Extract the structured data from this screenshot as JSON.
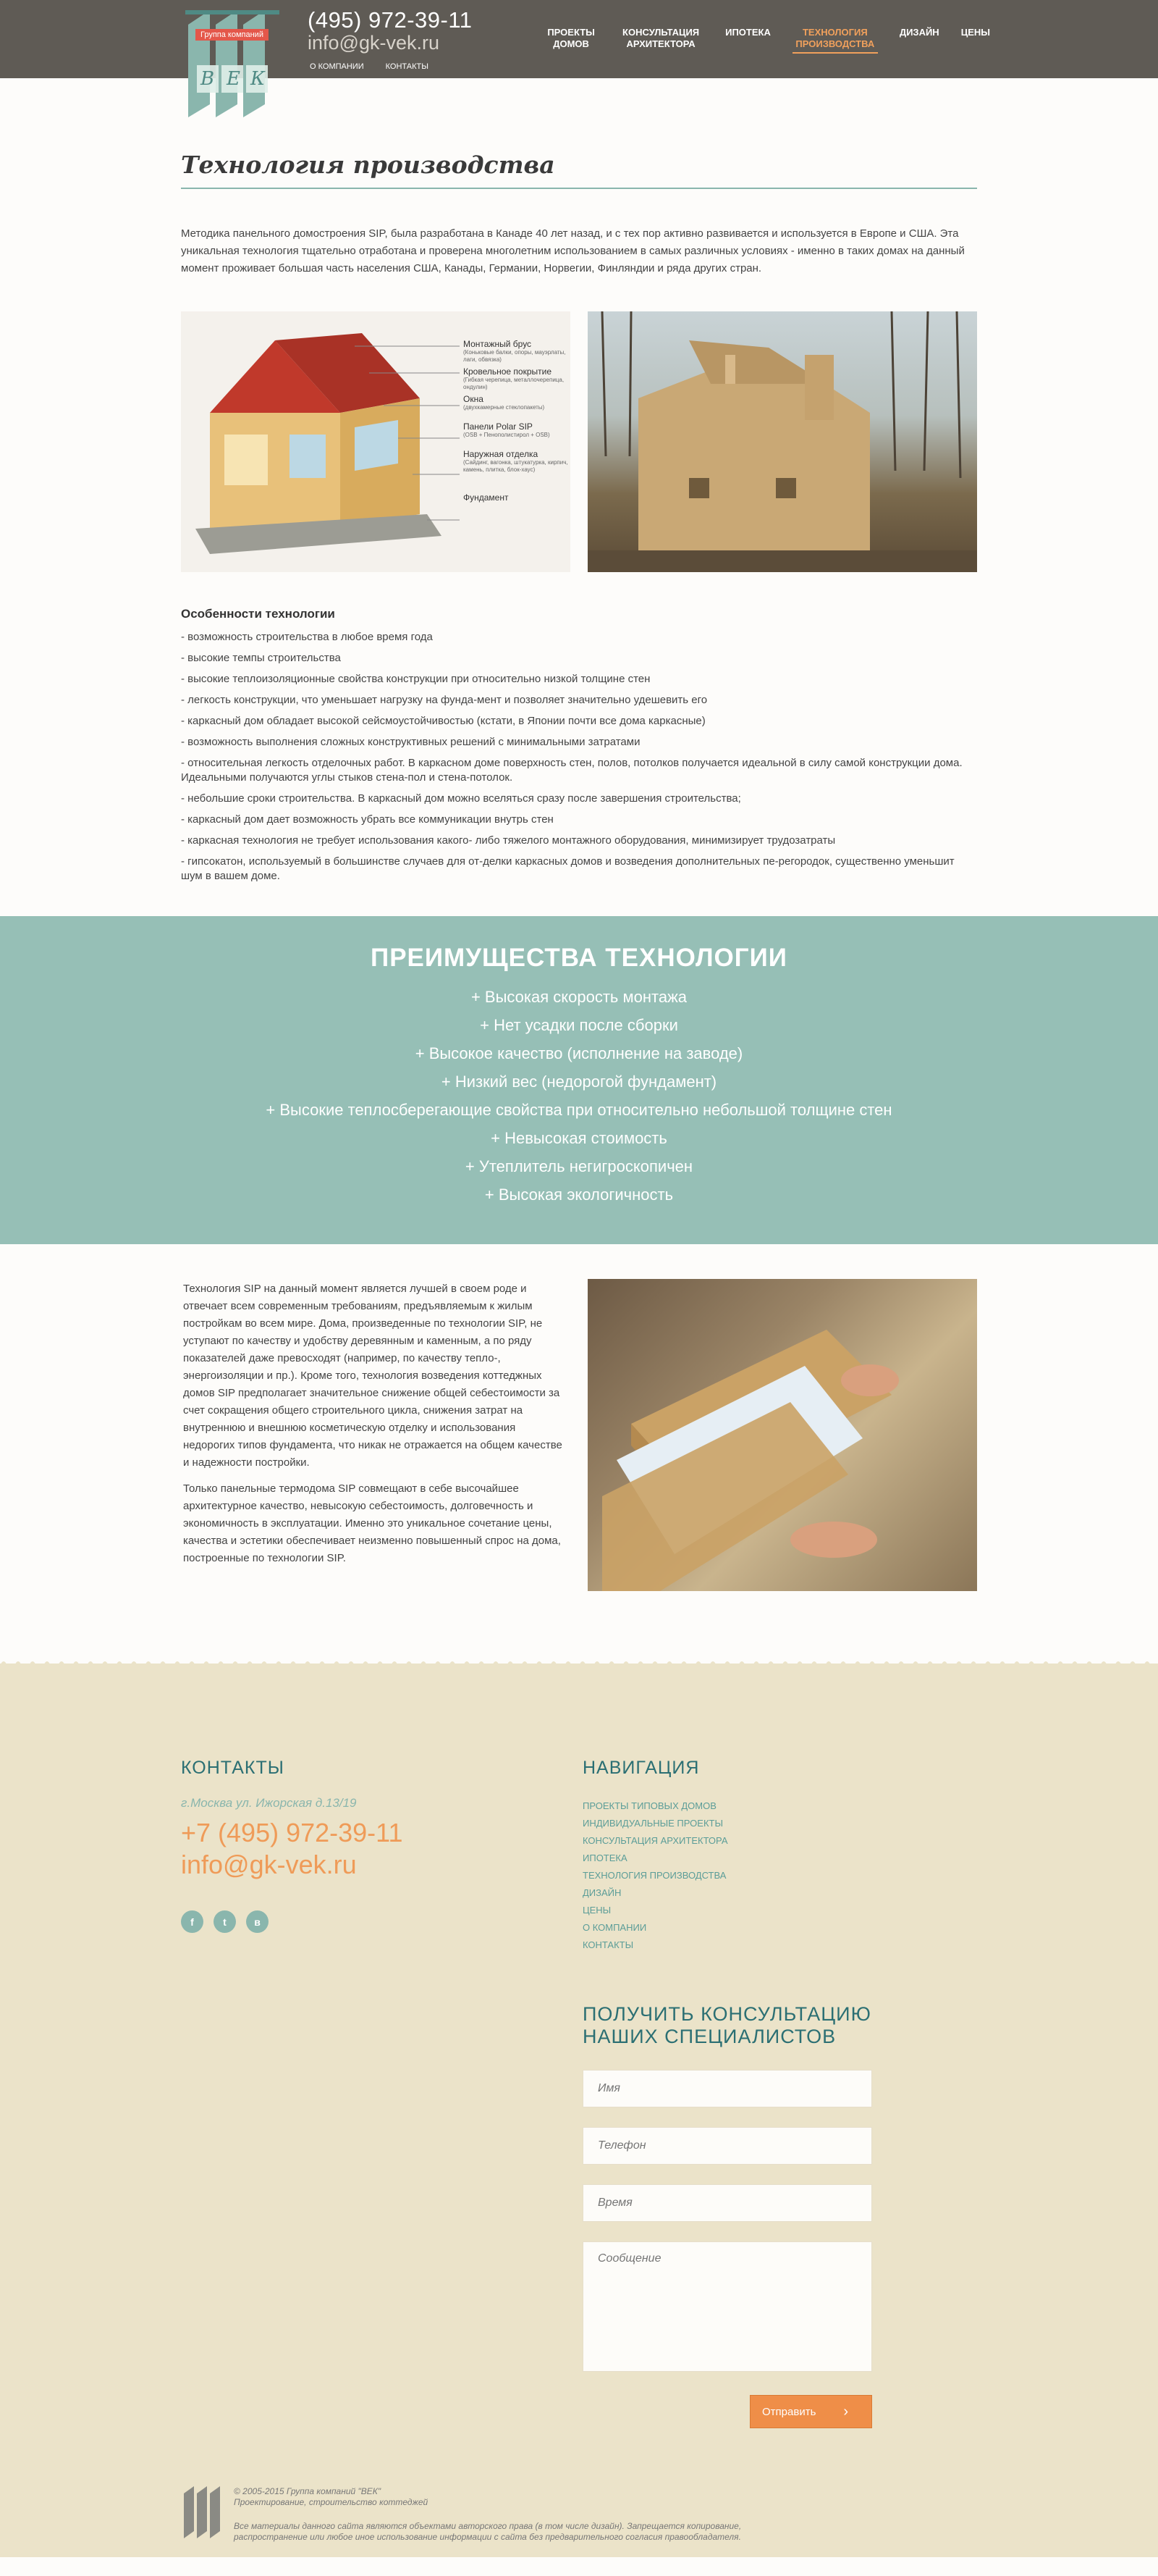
{
  "header": {
    "logo_badge": "Группа компаний",
    "logo_letters": [
      "В",
      "Е",
      "К"
    ],
    "phone": "(495) 972-39-11",
    "email": "info@gk-vek.ru",
    "top_links": [
      "О компании",
      "Контакты"
    ],
    "menu": [
      {
        "label": "ПРОЕКТЫ ДОМОВ",
        "active": false
      },
      {
        "label": "КОНСУЛЬТАЦИЯ АРХИТЕКТОРА",
        "active": false
      },
      {
        "label": "ИПОТЕКА",
        "active": false
      },
      {
        "label": "ТЕХНОЛОГИЯ ПРОИЗВОДСТВА",
        "active": true
      },
      {
        "label": "ДИЗАЙН",
        "active": false
      },
      {
        "label": "ЦЕНЫ",
        "active": false
      }
    ]
  },
  "page": {
    "title": "Технология производства",
    "intro": "Методика панельного домостроения SIP, была разработана в Канаде 40 лет назад, и с тех пор активно развивается и используется в Европе и США. Эта уникальная технология тщательно отработана и проверена многолетним использованием в самых различных условиях - именно в таких домах на данный момент проживает большая часть населения США, Канады, Германии, Норвегии, Финляндии и ряда других стран.",
    "diagram_labels": [
      {
        "title": "Монтажный брус",
        "sub": "(Коньковые балки, опоры, мауэрлаты, лаги, обвязка)"
      },
      {
        "title": "Кровельное покрытие",
        "sub": "(Гибкая черепица, металлочерепица, ондулин)"
      },
      {
        "title": "Окна",
        "sub": "(двухкамерные стеклопакеты)"
      },
      {
        "title": "Панели Polar SIP",
        "sub": "(OSB + Пенополистирол + OSB)"
      },
      {
        "title": "Наружная отделка",
        "sub": "(Сайдинг, вагонка, штукатурка, кирпич, камень, плитка, блок-хаус)"
      },
      {
        "title": "Фундамент",
        "sub": ""
      }
    ]
  },
  "features": {
    "heading": "Особенности технологии",
    "items": [
      "- возможность строительства в любое время года",
      "- высокие темпы строительства",
      "- высокие теплоизоляционные свойства конструкции при относительно низкой толщине стен",
      "- легкость конструкции, что уменьшает нагрузку на фунда-мент и позволяет значительно удешевить его",
      "- каркасный дом обладает высокой сейсмоустойчивостью (кстати, в Японии почти все дома каркасные)",
      "- возможность выполнения сложных конструктивных решений с минимальными затратами",
      "- относительная легкость отделочных работ. В каркасном доме поверхность стен, полов, потолков получается идеальной в силу самой конструкции дома. Идеальными получаются углы стыков стена-пол и стена-потолок.",
      "- небольшие сроки строительства. В каркасный дом можно вселяться сразу после завершения строительства;",
      "- каркасный дом дает возможность убрать все коммуникации внутрь стен",
      "- каркасная технология не требует использования какого- либо тяжелого монтажного оборудования, минимизирует трудозатраты",
      "- гипсокатон, используемый в большинстве случаев для от-делки каркасных домов и возведения дополнительных пе-регородок, существенно уменьшит шум в вашем доме."
    ]
  },
  "benefits": {
    "heading": "ПРЕИМУЩЕСТВА ТЕХНОЛОГИИ",
    "items": [
      "+ Высокая скорость монтажа",
      "+ Нет усадки после сборки",
      "+ Высокое качество (исполнение на заводе)",
      "+ Низкий вес (недорогой фундамент)",
      "+ Высокие теплосберегающие свойства при относительно небольшой толщине стен",
      "+ Невысокая стоимость",
      "+ Утеплитель негигроскопичен",
      "+ Высокая экологичность"
    ]
  },
  "sip": {
    "p1": "Технология SIP на данный момент является лучшей в своем роде и отвечает всем современным требованиям, предъявляемым к жилым постройкам во всем мире. Дома, произведенные по технологии SIP, не уступают по качеству и удобству деревянным и каменным, а по ряду показателей даже превосходят (например, по качеству тепло-, энергоизоляции и пр.). Кроме того, технология возведения коттеджных домов SIP предполагает значительное снижение общей себестоимости за счет сокращения общего строительного цикла, снижения затрат на внутреннюю и внешнюю косметическую отделку и использования недорогих типов фундамента, что никак не отражается на общем качестве и надежности постройки.",
    "p2": "Только панельные термодома SIP совмещают в себе высочайшее архитектурное качество, невысокую себестоимость, долговечность и экономичность в эксплуатации. Именно это уникальное сочетание цены, качества и эстетики обеспечивает неизменно повышенный спрос на дома, построенные по технологии SIP."
  },
  "footer": {
    "contacts_heading": "КОНТАКТЫ",
    "address": "г.Москва ул. Ижорская д.13/19",
    "phone": "+7 (495) 972-39-11",
    "email": "info@gk-vek.ru",
    "socials": [
      "f",
      "t",
      "в"
    ],
    "nav_heading": "НАВИГАЦИЯ",
    "nav_items": [
      "ПРОЕКТЫ ТИПОВЫХ ДОМОВ",
      "ИНДИВИДУАЛЬНЫЕ ПРОЕКТЫ",
      "КОНСУЛЬТАЦИЯ АРХИТЕКТОРА",
      "ИПОТЕКА",
      "ТЕХНОЛОГИЯ ПРОИЗВОДСТВА",
      "ДИЗАЙН",
      "ЦЕНЫ",
      "О КОМПАНИИ",
      "КОНТАКТЫ"
    ],
    "consult_heading": "ПОЛУЧИТЬ КОНСУЛЬТАЦИЮ НАШИХ СПЕЦИАЛИСТОВ",
    "form": {
      "name_placeholder": "Имя",
      "phone_placeholder": "Телефон",
      "time_placeholder": "Время",
      "message_placeholder": "Сообщение",
      "submit_label": "Отправить"
    },
    "copyright_line1": "© 2005-2015 Группа компаний \"ВЕК\"",
    "copyright_line2": "Проектирование, строительство коттеджей",
    "copyright_line3": "Все материалы данного сайта являются объектами авторского права (в том числе дизайн). Запрещается копирование,",
    "copyright_line4": "распространение или любое иное использование информации с сайта без предварительного согласия правообладателя."
  }
}
